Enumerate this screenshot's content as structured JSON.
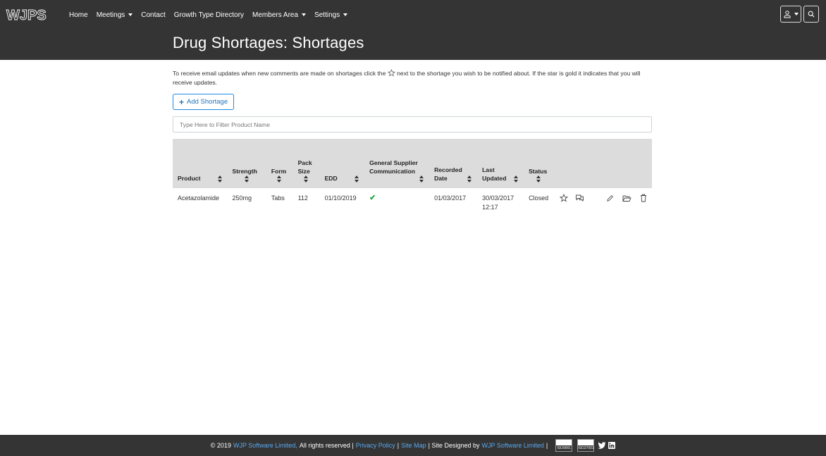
{
  "nav": {
    "logo_text": "WJPS",
    "items": [
      {
        "label": "Home",
        "dropdown": false
      },
      {
        "label": "Meetings",
        "dropdown": true
      },
      {
        "label": "Contact",
        "dropdown": false
      },
      {
        "label": "Growth Type Directory",
        "dropdown": false
      },
      {
        "label": "Members Area",
        "dropdown": true
      },
      {
        "label": "Settings",
        "dropdown": true
      }
    ]
  },
  "page": {
    "title": "Drug Shortages: Shortages",
    "intro_before_star": "To receive email updates when new comments are made on shortages click the",
    "intro_after_star": "next to the shortage you wish to be notified about. If the star is gold it indicates that you will receive updates.",
    "add_button": "Add Shortage",
    "filter_placeholder": "Type Here to Filter Product Name"
  },
  "table": {
    "headers": [
      "Product",
      "Strength",
      "Form",
      "Pack Size",
      "EDD",
      "General Supplier Communication",
      "Recorded Date",
      "Last Updated",
      "Status"
    ],
    "rows": [
      {
        "product": "Acetazolamide",
        "strength": "250mg",
        "form": "Tabs",
        "pack_size": "112",
        "edd": "01/10/2019",
        "general_supplier_communication": "✔",
        "recorded_date": "01/03/2017",
        "last_updated": "30/03/2017 12:17",
        "status": "Closed"
      }
    ]
  },
  "footer": {
    "copyright_prefix": "© 2019",
    "company_link": "WJP Software Limited,",
    "rights": "All rights reserved |",
    "privacy": "Privacy Policy",
    "sep1": "|",
    "sitemap": "Site Map",
    "designed_by": "| Site Designed by",
    "designer_link": "WJP Software Limited",
    "sep2": "|",
    "badge1": "ISO9001",
    "badge2": "ISO27001"
  },
  "colors": {
    "topbar": "#343434",
    "link": "#5aa9f0",
    "accent": "#1e88e5",
    "check": "#28a745"
  }
}
